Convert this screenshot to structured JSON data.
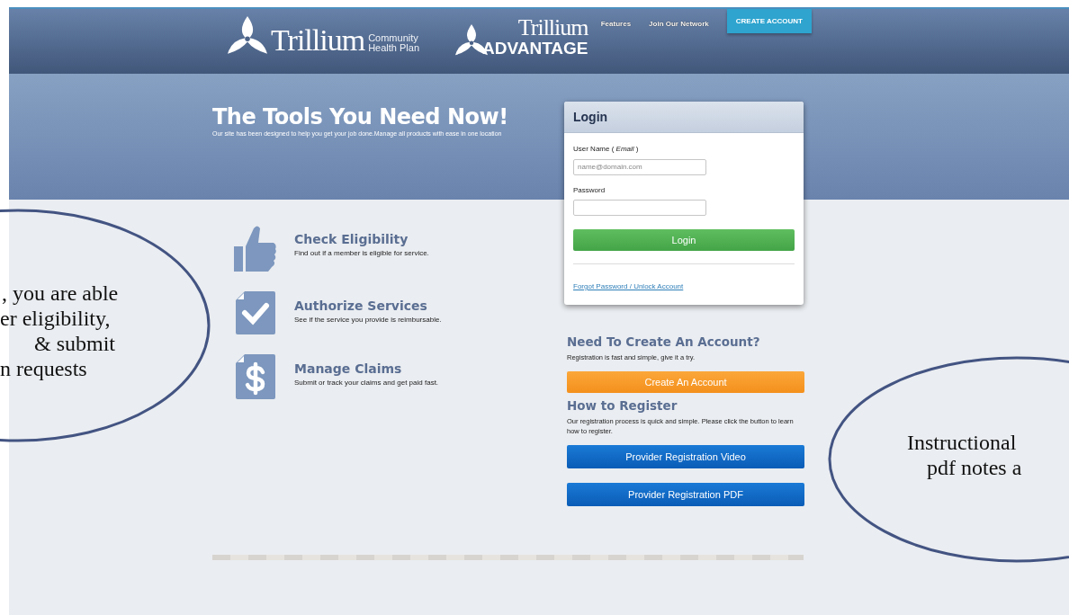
{
  "header": {
    "logos": [
      {
        "kind": "community",
        "name": "Trillium",
        "tagline": [
          "Community",
          "Health Plan"
        ]
      },
      {
        "kind": "advantage",
        "name": "Trillium",
        "tagline": [
          "ADVANTAGE"
        ]
      }
    ],
    "nav": [
      {
        "label": "Features",
        "kind": "link"
      },
      {
        "label": "Join Our Network",
        "kind": "link"
      },
      {
        "label": "CREATE ACCOUNT",
        "kind": "button"
      }
    ]
  },
  "hero": {
    "title": "The Tools You Need Now!",
    "subtitle": "Our site has been designed to help you get your job done.Manage all products with ease in one location"
  },
  "features": [
    {
      "title": "Check Eligibility",
      "text": "Find out if a member is eligible for service."
    },
    {
      "title": "Authorize Services",
      "text": "See if the service you provide is reimbursable."
    },
    {
      "title": "Manage Claims",
      "text": "Submit or track your claims and get paid fast."
    }
  ],
  "login": {
    "title": "Login",
    "fields": [
      {
        "label": "User Name  ( *Email* )",
        "placeholder": "name@domain.com"
      },
      {
        "label": "Password"
      }
    ],
    "button": "Login",
    "link": "Forgot Password / Unlock Account"
  },
  "register": {
    "sections": [
      {
        "heading": "Need To Create An Account?",
        "text": "Registration is fast and simple, give it a try.",
        "buttons": [
          {
            "label": "Create An Account",
            "kind": "orange"
          }
        ]
      },
      {
        "heading": "How to Register",
        "text": "Our registration process is quick and simple. Please click the button to learn how to register.",
        "buttons": [
          {
            "label": "Provider Registration Video",
            "kind": "blue"
          },
          {
            "label": "Provider Registration PDF",
            "kind": "blue"
          }
        ]
      }
    ]
  },
  "callouts": [
    {
      "lines": [
        ", you are able",
        "er eligibility,",
        "& submit",
        "n requests"
      ]
    },
    {
      "lines": [
        "Instructional",
        "pdf notes a"
      ]
    }
  ]
}
